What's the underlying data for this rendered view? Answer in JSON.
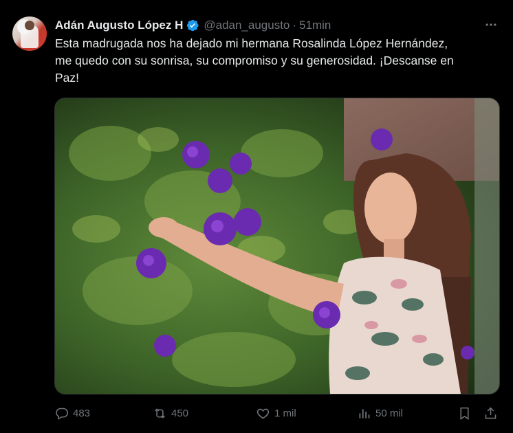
{
  "tweet": {
    "author_name": "Adán Augusto López H",
    "handle": "@adan_augusto",
    "separator": "·",
    "time": "51min",
    "text_lines": [
      "Esta madrugada nos ha dejado mi hermana Rosalinda López Hernández,",
      "me quedo con su sonrisa, su compromiso y su generosidad. ¡Descanse en",
      "Paz!"
    ]
  },
  "actions": {
    "replies": "483",
    "reposts": "450",
    "likes": "1 mil",
    "views": "50 mil"
  },
  "colors": {
    "background": "#000000",
    "text": "#e7e9ea",
    "muted": "#71767b",
    "verified": "#1d9bf0"
  }
}
